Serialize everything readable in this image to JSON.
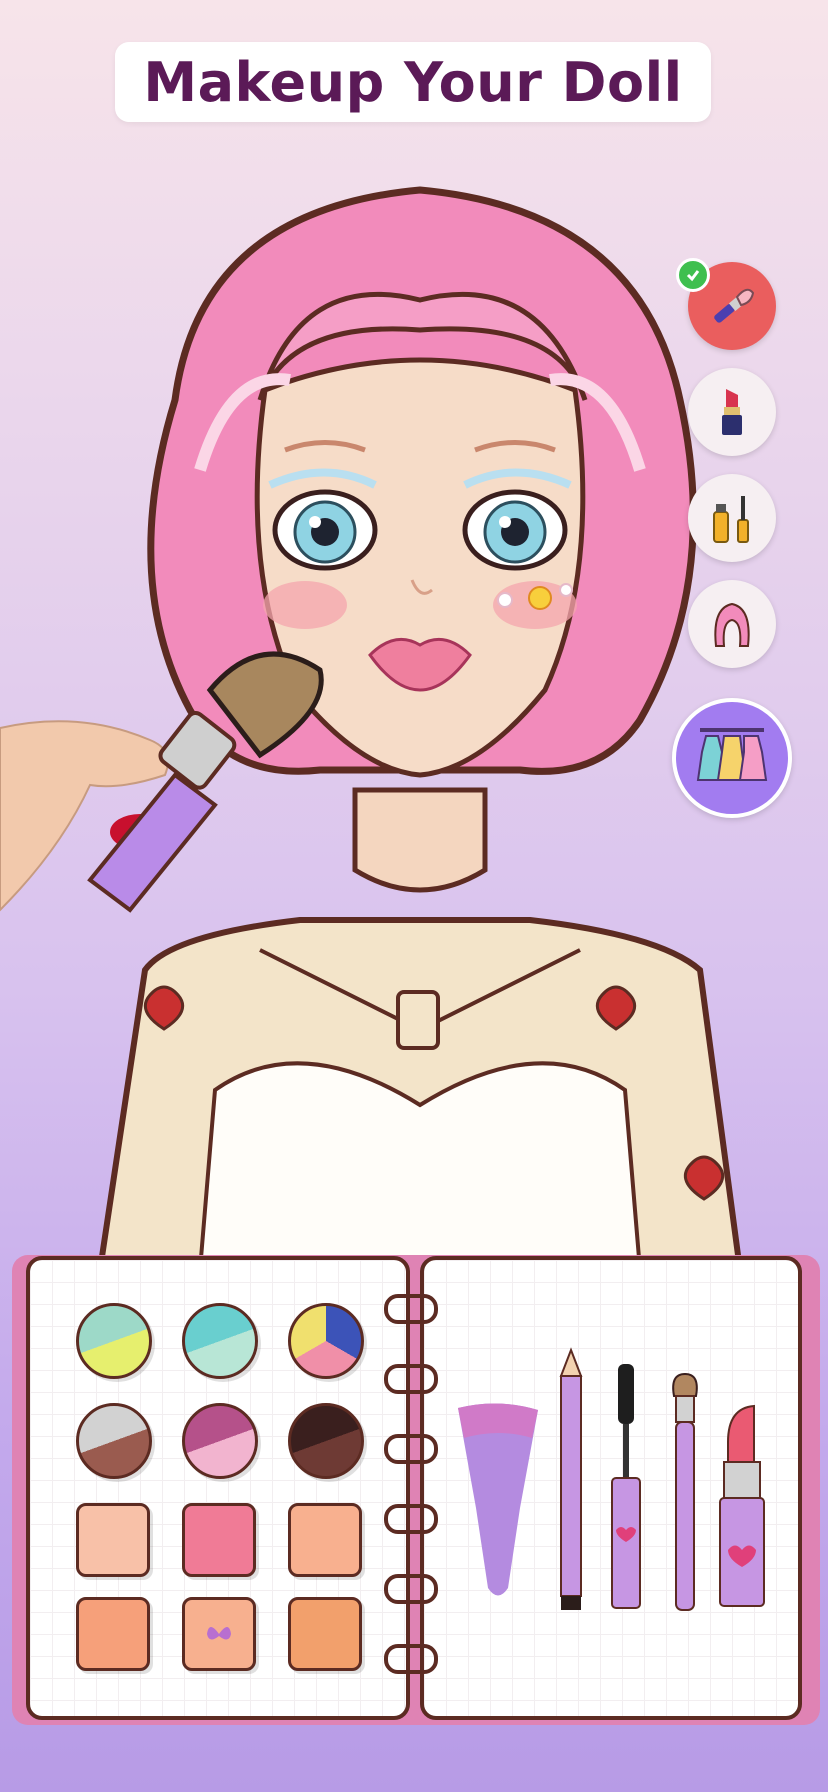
{
  "title": "Makeup Your Doll",
  "sidebar": {
    "tools": [
      {
        "name": "blush-brush",
        "icon": "blush-brush-icon",
        "state": "active",
        "completed": true,
        "color": "#ea5e5e"
      },
      {
        "name": "lipstick",
        "icon": "lipstick-icon",
        "state": "idle",
        "completed": false
      },
      {
        "name": "eye-makeup",
        "icon": "mascara-icon",
        "state": "idle",
        "completed": false
      },
      {
        "name": "hair",
        "icon": "hair-icon",
        "state": "idle",
        "completed": false
      },
      {
        "name": "outfits",
        "icon": "dresses-icon",
        "state": "highlighted",
        "completed": false,
        "color": "#a27cf0"
      }
    ]
  },
  "palette": {
    "eyeshadows": [
      {
        "name": "green-cyan",
        "colors": [
          "#9dd9c8",
          "#e6ef6e"
        ]
      },
      {
        "name": "cyan-mint",
        "colors": [
          "#69cfcf",
          "#b8e6d6"
        ]
      },
      {
        "name": "blue-pink-yellow",
        "colors": [
          "#3c53b8",
          "#f08fa8",
          "#f0e06e"
        ]
      },
      {
        "name": "silver-brown",
        "colors": [
          "#d2d2d2",
          "#9a5b4f"
        ]
      },
      {
        "name": "mauve-pink",
        "colors": [
          "#b5518a",
          "#f2b4cf"
        ]
      },
      {
        "name": "dark-brown",
        "colors": [
          "#3a1f1e",
          "#6e3a34"
        ]
      }
    ],
    "blushes": [
      {
        "name": "peach-sticker",
        "color": "#f8c1a8"
      },
      {
        "name": "rose",
        "color": "#f07b96"
      },
      {
        "name": "coral",
        "color": "#f8b08f"
      },
      {
        "name": "apricot",
        "color": "#f6a07a"
      },
      {
        "name": "butterfly-peach",
        "color": "#f7b08f"
      },
      {
        "name": "tan",
        "color": "#f2a06c"
      }
    ]
  },
  "tools": [
    "foundation-sponge",
    "eyeliner-pencil",
    "mascara",
    "blush-brush",
    "lipstick"
  ],
  "colors": {
    "accent": "#5b1a57",
    "book": "#df83b4",
    "outline": "#5c2b22",
    "tool": "#c696e3"
  }
}
